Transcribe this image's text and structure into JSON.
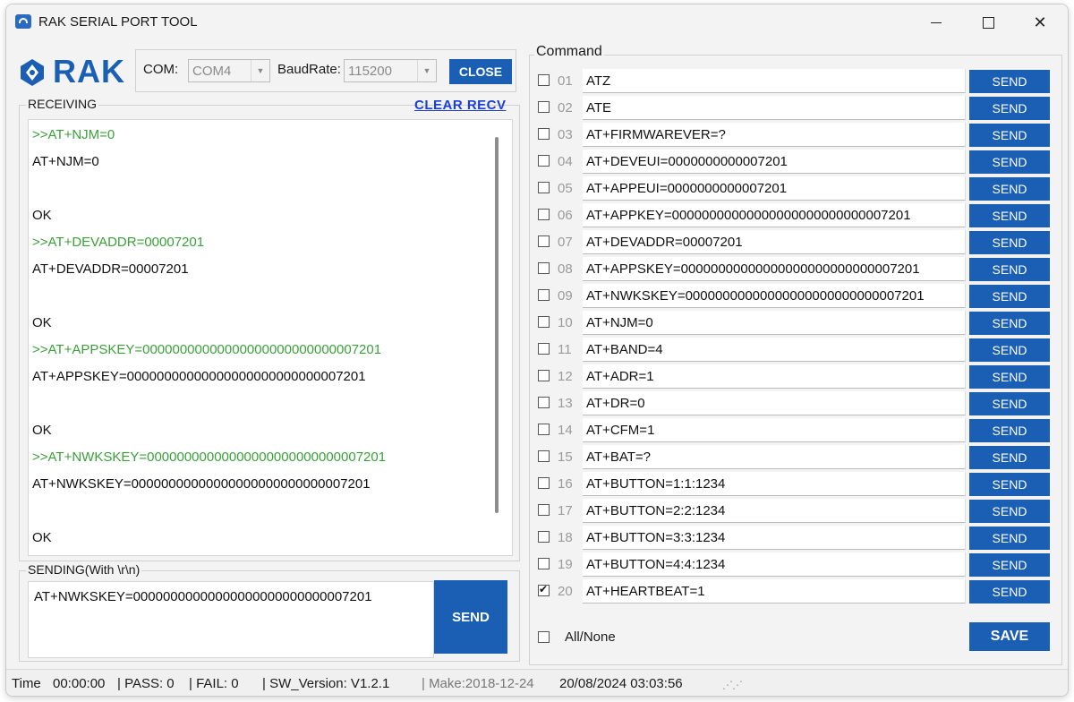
{
  "window": {
    "title": "RAK SERIAL PORT TOOL"
  },
  "logo": {
    "text": "RAK"
  },
  "connection": {
    "com_label": "COM:",
    "com_value": "COM4",
    "baud_label": "BaudRate:",
    "baud_value": "115200",
    "close_label": "CLOSE"
  },
  "receiving": {
    "title": "RECEIVING",
    "clear_label": "CLEAR RECV",
    "lines": [
      {
        "text": ">>AT+NJM=0",
        "kind": "sent"
      },
      {
        "text": "AT+NJM=0",
        "kind": "resp"
      },
      {
        "text": "",
        "kind": "resp"
      },
      {
        "text": "OK",
        "kind": "resp"
      },
      {
        "text": ">>AT+DEVADDR=00007201",
        "kind": "sent"
      },
      {
        "text": "AT+DEVADDR=00007201",
        "kind": "resp"
      },
      {
        "text": "",
        "kind": "resp"
      },
      {
        "text": "OK",
        "kind": "resp"
      },
      {
        "text": ">>AT+APPSKEY=00000000000000000000000000007201",
        "kind": "sent"
      },
      {
        "text": "AT+APPSKEY=00000000000000000000000000007201",
        "kind": "resp"
      },
      {
        "text": "",
        "kind": "resp"
      },
      {
        "text": "OK",
        "kind": "resp"
      },
      {
        "text": ">>AT+NWKSKEY=00000000000000000000000000007201",
        "kind": "sent"
      },
      {
        "text": "AT+NWKSKEY=00000000000000000000000000007201",
        "kind": "resp"
      },
      {
        "text": "",
        "kind": "resp"
      },
      {
        "text": "OK",
        "kind": "resp"
      }
    ]
  },
  "sending": {
    "title": "SENDING(With \\r\\n)",
    "value": "AT+NWKSKEY=00000000000000000000000000007201",
    "send_label": "SEND"
  },
  "command": {
    "title": "Command",
    "send_label": "SEND",
    "rows": [
      {
        "index": "01",
        "text": "ATZ",
        "checked": false
      },
      {
        "index": "02",
        "text": "ATE",
        "checked": false
      },
      {
        "index": "03",
        "text": "AT+FIRMWAREVER=?",
        "checked": false
      },
      {
        "index": "04",
        "text": "AT+DEVEUI=0000000000007201",
        "checked": false
      },
      {
        "index": "05",
        "text": "AT+APPEUI=0000000000007201",
        "checked": false
      },
      {
        "index": "06",
        "text": "AT+APPKEY=00000000000000000000000000007201",
        "checked": false
      },
      {
        "index": "07",
        "text": "AT+DEVADDR=00007201",
        "checked": false
      },
      {
        "index": "08",
        "text": "AT+APPSKEY=00000000000000000000000000007201",
        "checked": false
      },
      {
        "index": "09",
        "text": "AT+NWKSKEY=00000000000000000000000000007201",
        "checked": false
      },
      {
        "index": "10",
        "text": "AT+NJM=0",
        "checked": false
      },
      {
        "index": "11",
        "text": "AT+BAND=4",
        "checked": false
      },
      {
        "index": "12",
        "text": "AT+ADR=1",
        "checked": false
      },
      {
        "index": "13",
        "text": "AT+DR=0",
        "checked": false
      },
      {
        "index": "14",
        "text": "AT+CFM=1",
        "checked": false
      },
      {
        "index": "15",
        "text": "AT+BAT=?",
        "checked": false
      },
      {
        "index": "16",
        "text": "AT+BUTTON=1:1:1234",
        "checked": false
      },
      {
        "index": "17",
        "text": "AT+BUTTON=2:2:1234",
        "checked": false
      },
      {
        "index": "18",
        "text": "AT+BUTTON=3:3:1234",
        "checked": false
      },
      {
        "index": "19",
        "text": "AT+BUTTON=4:4:1234",
        "checked": false
      },
      {
        "index": "20",
        "text": "AT+HEARTBEAT=1",
        "checked": true
      }
    ],
    "all_none_label": "All/None",
    "save_label": "SAVE"
  },
  "status": {
    "time_label": "Time",
    "time_value": "00:00:00",
    "pass_text": "| PASS:  0",
    "fail_text": "| FAIL:  0",
    "sw_text": "| SW_Version:  V1.2.1",
    "make_text": "| Make:2018-12-24",
    "datetime": "20/08/2024 03:03:56"
  },
  "colors": {
    "accent": "#1a5fb4",
    "sent_text": "#3aa13a",
    "link": "#1a3fd6"
  }
}
